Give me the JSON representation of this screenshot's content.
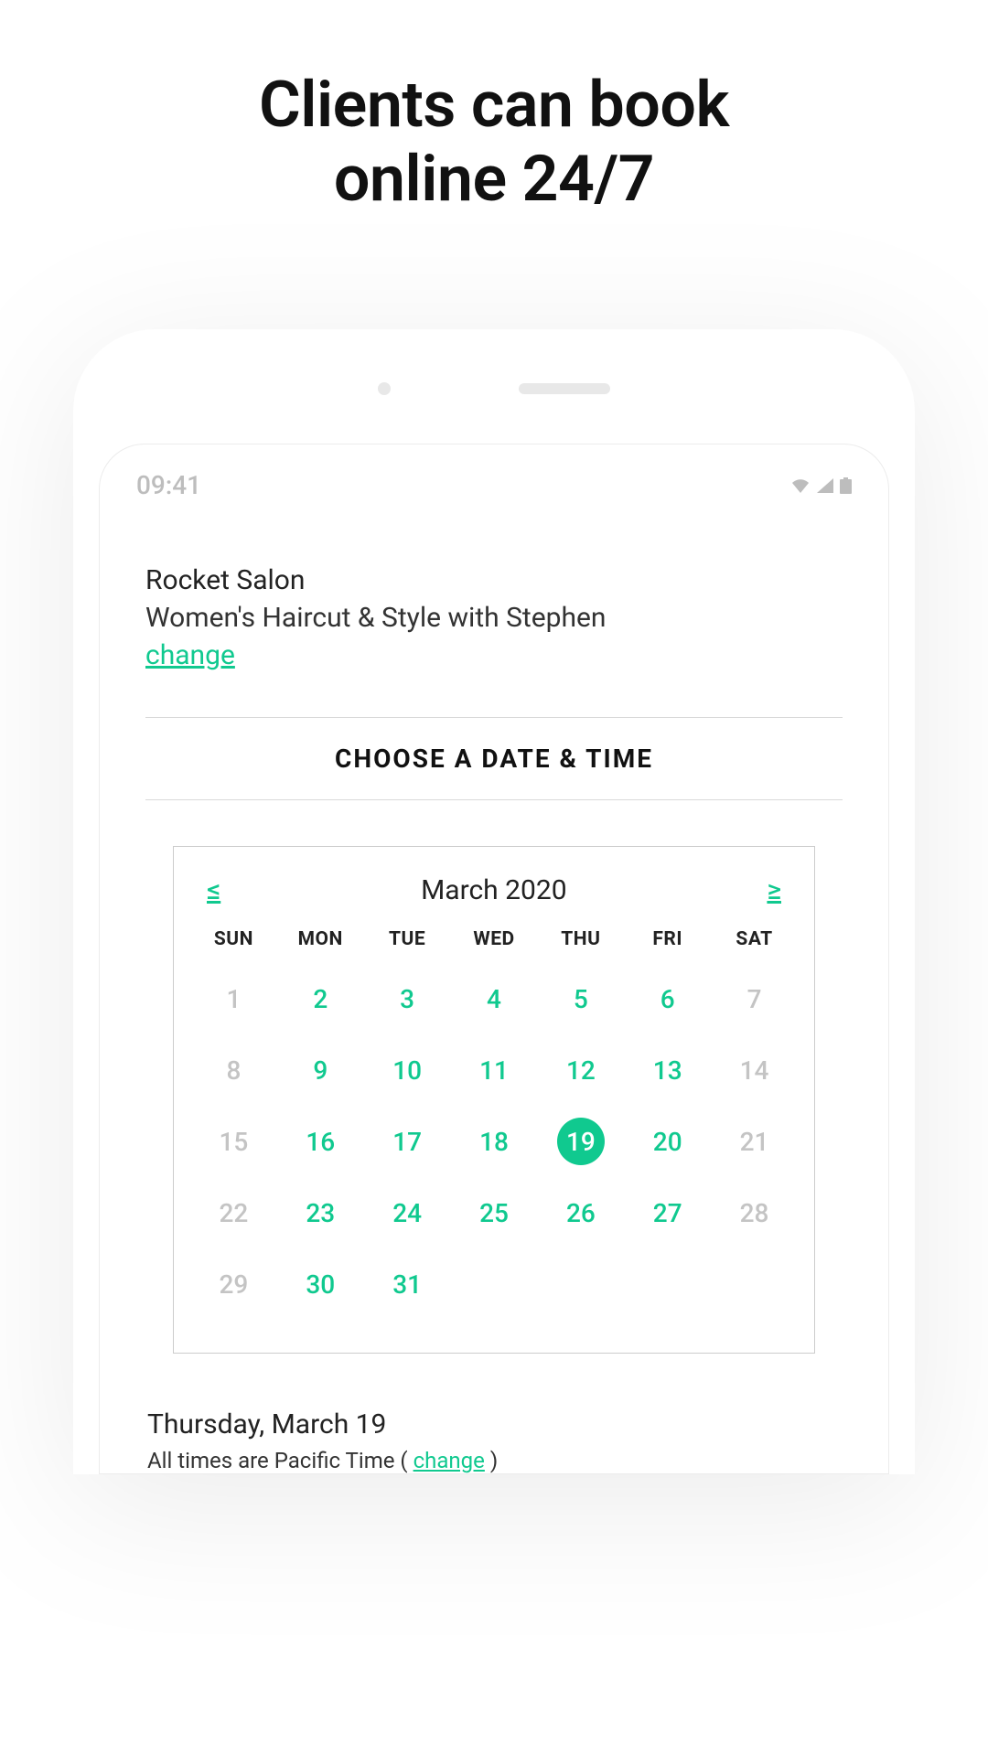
{
  "headline_line1": "Clients can book",
  "headline_line2": "online 24/7",
  "status": {
    "time": "09:41"
  },
  "booking": {
    "salon": "Rocket Salon",
    "service": "Women's Haircut & Style with Stephen",
    "change_label": "change"
  },
  "section_title": "CHOOSE A DATE & TIME",
  "calendar": {
    "prev": "≤",
    "next": "≥",
    "month_label": "March 2020",
    "dow": [
      "SUN",
      "MON",
      "TUE",
      "WED",
      "THU",
      "FRI",
      "SAT"
    ],
    "days": [
      {
        "n": "1",
        "state": "unavailable"
      },
      {
        "n": "2",
        "state": "available"
      },
      {
        "n": "3",
        "state": "available"
      },
      {
        "n": "4",
        "state": "available"
      },
      {
        "n": "5",
        "state": "available"
      },
      {
        "n": "6",
        "state": "available"
      },
      {
        "n": "7",
        "state": "unavailable"
      },
      {
        "n": "8",
        "state": "unavailable"
      },
      {
        "n": "9",
        "state": "available"
      },
      {
        "n": "10",
        "state": "available"
      },
      {
        "n": "11",
        "state": "available"
      },
      {
        "n": "12",
        "state": "available"
      },
      {
        "n": "13",
        "state": "available"
      },
      {
        "n": "14",
        "state": "unavailable"
      },
      {
        "n": "15",
        "state": "unavailable"
      },
      {
        "n": "16",
        "state": "available"
      },
      {
        "n": "17",
        "state": "available"
      },
      {
        "n": "18",
        "state": "available"
      },
      {
        "n": "19",
        "state": "selected"
      },
      {
        "n": "20",
        "state": "available"
      },
      {
        "n": "21",
        "state": "unavailable"
      },
      {
        "n": "22",
        "state": "unavailable"
      },
      {
        "n": "23",
        "state": "available"
      },
      {
        "n": "24",
        "state": "available"
      },
      {
        "n": "25",
        "state": "available"
      },
      {
        "n": "26",
        "state": "available"
      },
      {
        "n": "27",
        "state": "available"
      },
      {
        "n": "28",
        "state": "unavailable"
      },
      {
        "n": "29",
        "state": "unavailable"
      },
      {
        "n": "30",
        "state": "available"
      },
      {
        "n": "31",
        "state": "available"
      }
    ]
  },
  "selected": {
    "date_label": "Thursday, March 19",
    "tz_prefix": "All times are Pacific Time ( ",
    "tz_change": "change",
    "tz_suffix": " )"
  }
}
